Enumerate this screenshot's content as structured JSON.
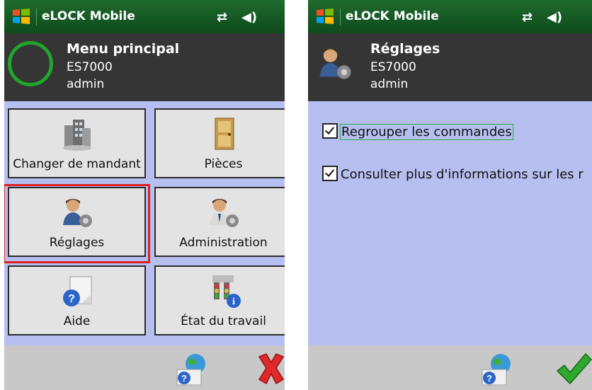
{
  "app": {
    "title": "eLOCK Mobile"
  },
  "left_screen": {
    "header": {
      "title": "Menu principal",
      "device": "ES7000",
      "user": "admin"
    },
    "tiles": [
      {
        "label": "Changer de mandant",
        "icon": "buildings-icon"
      },
      {
        "label": "Pièces",
        "icon": "door-icon"
      },
      {
        "label": "Réglages",
        "icon": "user-settings-icon",
        "highlighted": true
      },
      {
        "label": "Administration",
        "icon": "admin-settings-icon"
      },
      {
        "label": "Aide",
        "icon": "help-icon"
      },
      {
        "label": "État du travail",
        "icon": "traffic-light-info-icon"
      }
    ],
    "bottom": {
      "left_icon": "globe-help-icon",
      "right_icon": "close-x-icon"
    }
  },
  "right_screen": {
    "header": {
      "title": "Réglages",
      "device": "ES7000",
      "user": "admin"
    },
    "options": [
      {
        "label": "Regrouper les commandes",
        "checked": true
      },
      {
        "label": "Consulter plus d'informations sur les r",
        "checked": true
      }
    ],
    "bottom": {
      "left_icon": "globe-help-icon",
      "right_icon": "checkmark-icon"
    }
  },
  "colors": {
    "titlebar": "#1f6b2e",
    "header": "#353535",
    "content_bg": "#b7bff0",
    "highlight": "#e02020",
    "ring": "#1fa62a"
  }
}
